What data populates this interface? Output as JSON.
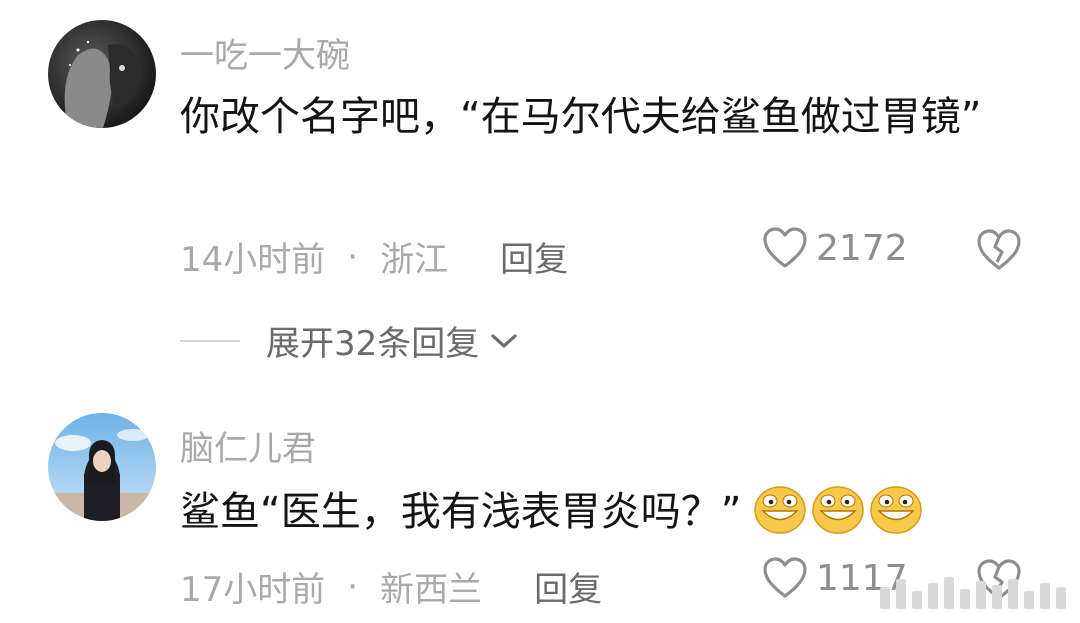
{
  "comments": [
    {
      "username": "一吃一大碗",
      "text": "你改个名字吧，“在马尔代夫给鲨鱼做过胃镜”",
      "time": "14小时前",
      "location": "浙江",
      "reply_label": "回复",
      "likes": "2172",
      "expand_label": "展开32条回复"
    },
    {
      "username": "脑仁儿君",
      "text": "鲨鱼“医生，我有浅表胃炎吗？”",
      "time": "17小时前",
      "location": "新西兰",
      "reply_label": "回复",
      "likes": "1117",
      "emojis": [
        "grin-emoji",
        "grin-emoji",
        "grin-emoji"
      ]
    }
  ],
  "separator": "·",
  "colors": {
    "text": "#141414",
    "muted": "#a9a9a9",
    "action": "#6b6b6b",
    "icon": "#8e8e8e"
  }
}
